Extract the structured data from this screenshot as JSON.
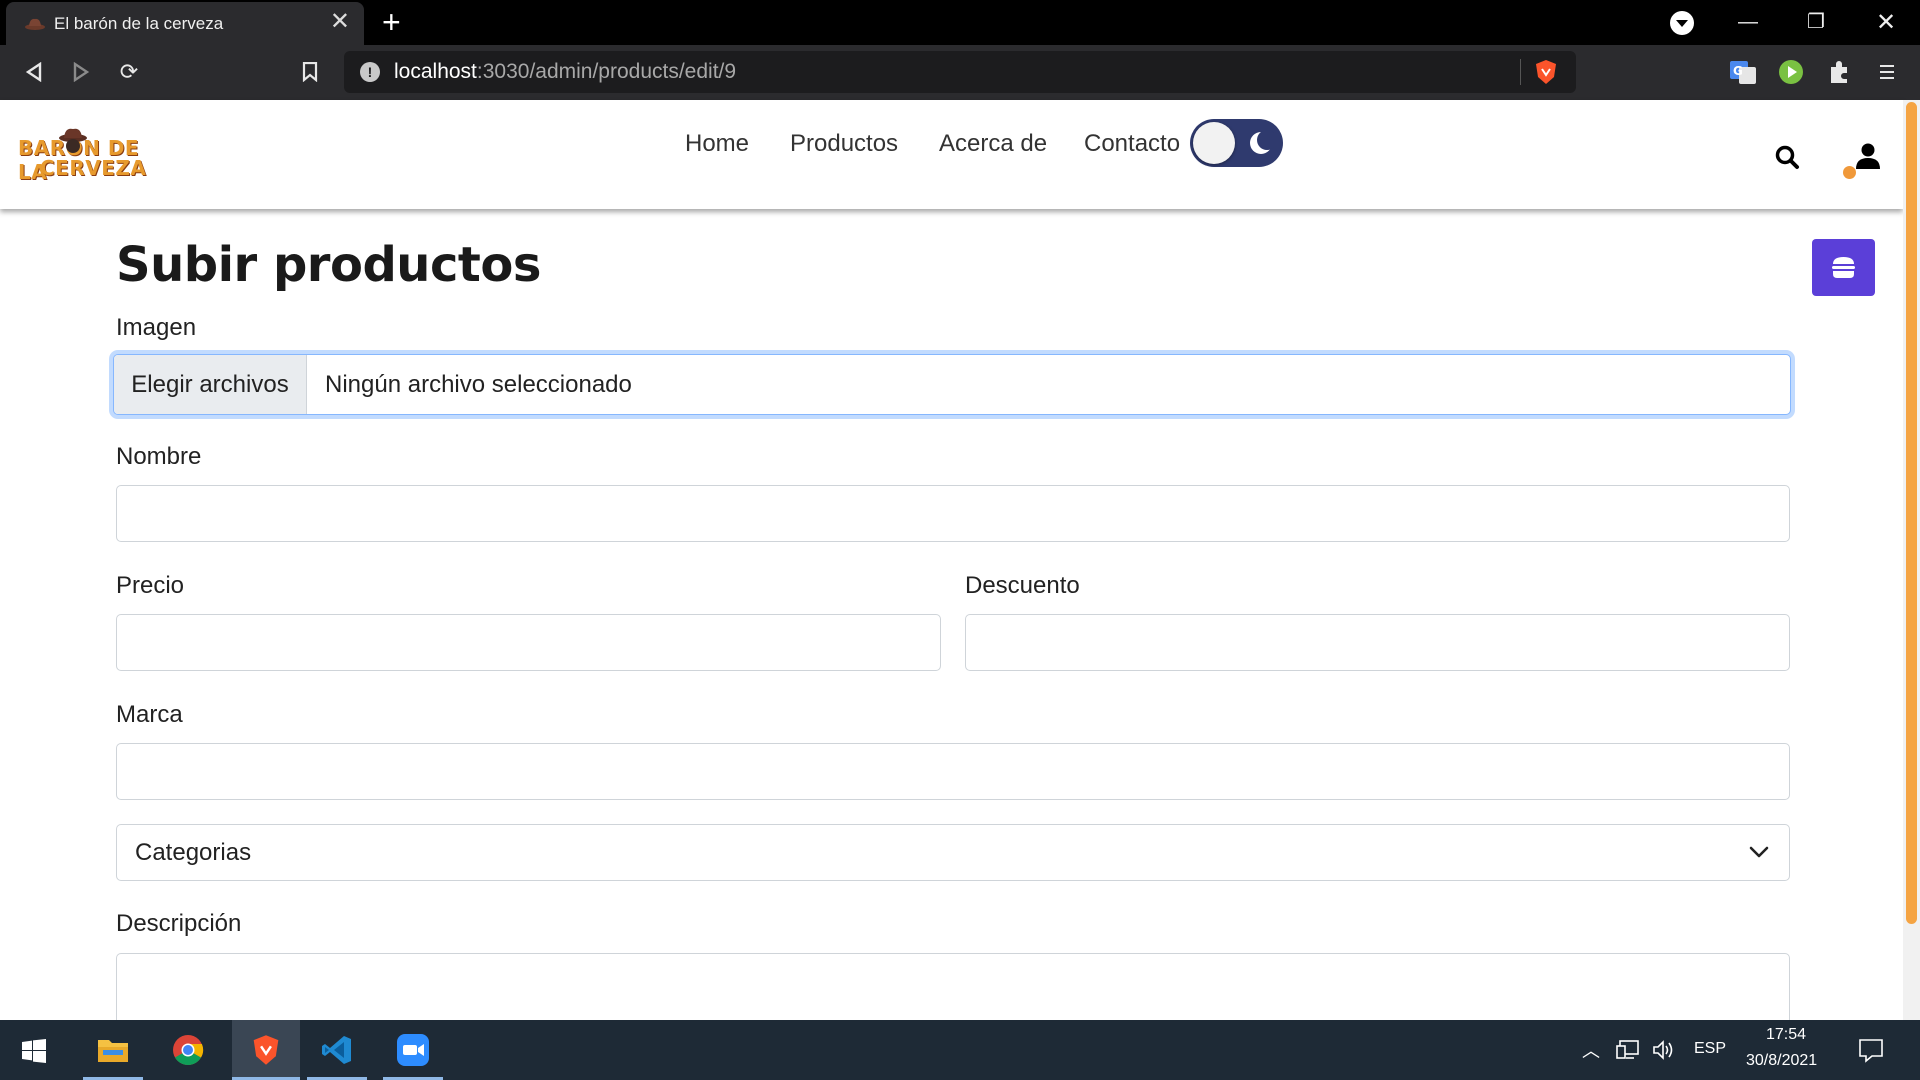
{
  "browser": {
    "tab_title": "El barón de la cerveza",
    "url_host": "localhost",
    "url_rest": ":3030/admin/products/edit/9"
  },
  "site": {
    "logo_line1": "BARÓN DE LA",
    "logo_line2": "CERVEZA",
    "nav": [
      "Home",
      "Productos",
      "Acerca de",
      "Contacto"
    ],
    "dark_mode_on": true
  },
  "form": {
    "title": "Subir productos",
    "image_label": "Imagen",
    "file_button": "Elegir archivos",
    "file_status": "Ningún archivo seleccionado",
    "name_label": "Nombre",
    "name_value": "",
    "price_label": "Precio",
    "price_value": "",
    "discount_label": "Descuento",
    "discount_value": "",
    "brand_label": "Marca",
    "brand_value": "",
    "category_selected": "Categorias",
    "description_label": "Descripción"
  },
  "taskbar": {
    "language": "ESP",
    "time": "17:54",
    "date": "30/8/2021"
  },
  "colors": {
    "accent_purple": "#5b3fd8",
    "accent_orange": "#f5a443",
    "toggle_navy": "#2f3a6e",
    "logo_orange": "#e79a2d"
  }
}
